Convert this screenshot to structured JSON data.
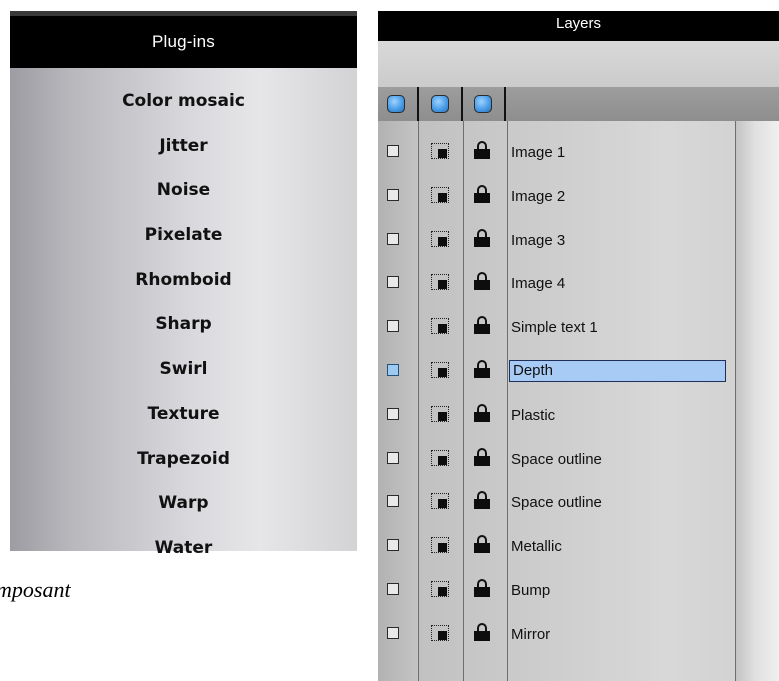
{
  "plugins": {
    "title": "Plug-ins",
    "items": [
      "Color mosaic",
      "Jitter",
      "Noise",
      "Pixelate",
      "Rhomboid",
      "Sharp",
      "Swirl",
      "Texture",
      "Trapezoid",
      "Warp",
      "Water"
    ]
  },
  "caption": {
    "text": "mposant"
  },
  "layers": {
    "title": "Layers",
    "selected_index": 5,
    "items": [
      {
        "name": "Image 1"
      },
      {
        "name": "Image 2"
      },
      {
        "name": "Image 3"
      },
      {
        "name": "Image 4"
      },
      {
        "name": "Simple text 1"
      },
      {
        "name": "Depth"
      },
      {
        "name": "Plastic"
      },
      {
        "name": "Space outline"
      },
      {
        "name": "Space outline"
      },
      {
        "name": "Metallic"
      },
      {
        "name": "Bump"
      },
      {
        "name": "Mirror"
      }
    ]
  },
  "icons": {
    "header_buttons": [
      "show-all-icon",
      "select-all-icon",
      "lock-all-icon"
    ],
    "visibility": "checkbox-icon",
    "selection": "selection-icon",
    "lock": "lock-icon"
  },
  "colors": {
    "panel_header": "#000000",
    "selection_highlight": "#a7cbf4",
    "selection_border": "#1f2f5a",
    "header_button": "#4a9ee8"
  }
}
